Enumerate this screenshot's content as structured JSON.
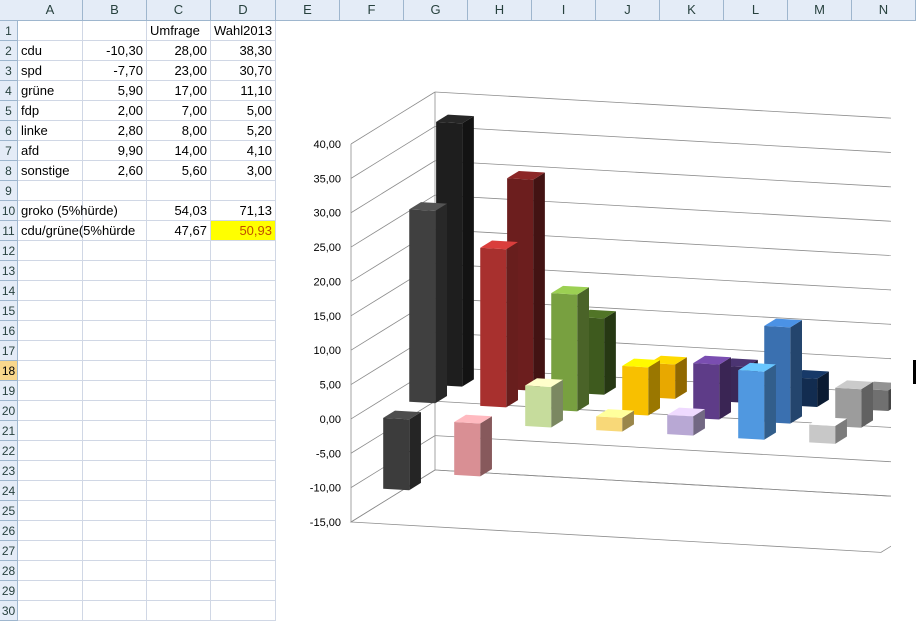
{
  "column_headers": [
    "A",
    "B",
    "C",
    "D",
    "E",
    "F",
    "G",
    "H",
    "I",
    "J",
    "K",
    "L",
    "M",
    "N"
  ],
  "row_numbers": [
    "1",
    "2",
    "3",
    "4",
    "5",
    "6",
    "7",
    "8",
    "9",
    "10",
    "11",
    "12",
    "13",
    "14",
    "15",
    "16",
    "17",
    "18",
    "19",
    "20",
    "21",
    "22",
    "23",
    "24",
    "25",
    "26",
    "27",
    "28",
    "29",
    "30"
  ],
  "active_row": "18",
  "rows": [
    {
      "a": "",
      "b": "",
      "c": "Umfrage",
      "d": "Wahl2013"
    },
    {
      "a": "cdu",
      "b": "-10,30",
      "c": "28,00",
      "d": "38,30"
    },
    {
      "a": "spd",
      "b": "-7,70",
      "c": "23,00",
      "d": "30,70"
    },
    {
      "a": "grüne",
      "b": "5,90",
      "c": "17,00",
      "d": "11,10"
    },
    {
      "a": "fdp",
      "b": "2,00",
      "c": "7,00",
      "d": "5,00"
    },
    {
      "a": "linke",
      "b": "2,80",
      "c": "8,00",
      "d": "5,20"
    },
    {
      "a": "afd",
      "b": "9,90",
      "c": "14,00",
      "d": "4,10"
    },
    {
      "a": "sonstige",
      "b": "2,60",
      "c": "5,60",
      "d": "3,00"
    },
    {
      "a": "",
      "b": "",
      "c": "",
      "d": ""
    },
    {
      "a": "groko (5%hürde)",
      "b": "",
      "c": "54,03",
      "d": "71,13"
    },
    {
      "a": "cdu/grüne(5%hürde",
      "b": "",
      "c": "47,67",
      "d": "50,93"
    }
  ],
  "highlight_color": "#ffff00",
  "chart_data": {
    "type": "bar",
    "categories": [
      "cdu",
      "spd",
      "grüne",
      "fdp",
      "linke",
      "afd",
      "sonstige"
    ],
    "series": [
      {
        "values": [
          -10.3,
          -7.7,
          5.9,
          2.0,
          2.8,
          9.9,
          2.6
        ]
      },
      {
        "values": [
          28.0,
          23.0,
          17.0,
          7.0,
          8.0,
          14.0,
          5.6
        ]
      },
      {
        "values": [
          38.3,
          30.7,
          11.1,
          5.0,
          5.2,
          4.1,
          3.0
        ]
      }
    ],
    "ylim": [
      -15,
      40
    ],
    "yticks": [
      "-15,00",
      "-10,00",
      "-5,00",
      "0,00",
      "5,00",
      "10,00",
      "15,00",
      "20,00",
      "25,00",
      "30,00",
      "35,00",
      "40,00"
    ],
    "grid": true,
    "colors": [
      [
        "#3c3c3c",
        "#d98f94",
        "#c6dc9c",
        "#f8d878",
        "#b8a8d4",
        "#5098e0",
        "#c8c8c8"
      ],
      [
        "#404040",
        "#a8302e",
        "#78a040",
        "#f8c000",
        "#5e3c88",
        "#3a70b0",
        "#9c9c9c"
      ],
      [
        "#1e1e1e",
        "#6c1e1e",
        "#3e5a1e",
        "#e8a800",
        "#3a2858",
        "#122c50",
        "#707070"
      ]
    ]
  }
}
